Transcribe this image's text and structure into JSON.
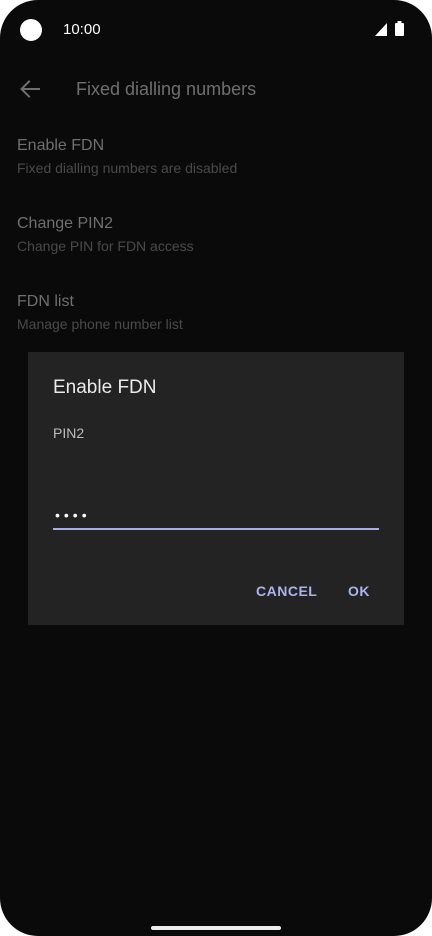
{
  "status_bar": {
    "time": "10:00",
    "icons": [
      "camera-dot",
      "signal-icon",
      "battery-icon"
    ]
  },
  "app_bar": {
    "back_icon": "arrow-left-icon",
    "title": "Fixed dialling numbers"
  },
  "preferences": [
    {
      "title": "Enable FDN",
      "summary": "Fixed dialling numbers are disabled"
    },
    {
      "title": "Change PIN2",
      "summary": "Change PIN for FDN access"
    },
    {
      "title": "FDN list",
      "summary": "Manage phone number list"
    }
  ],
  "dialog": {
    "title": "Enable FDN",
    "field_label": "PIN2",
    "pin_value": "••••",
    "cancel_label": "CANCEL",
    "ok_label": "OK",
    "accent_color": "#aab3f0"
  },
  "colors": {
    "background": "#0a0a0a",
    "dialog_background": "#232323"
  }
}
